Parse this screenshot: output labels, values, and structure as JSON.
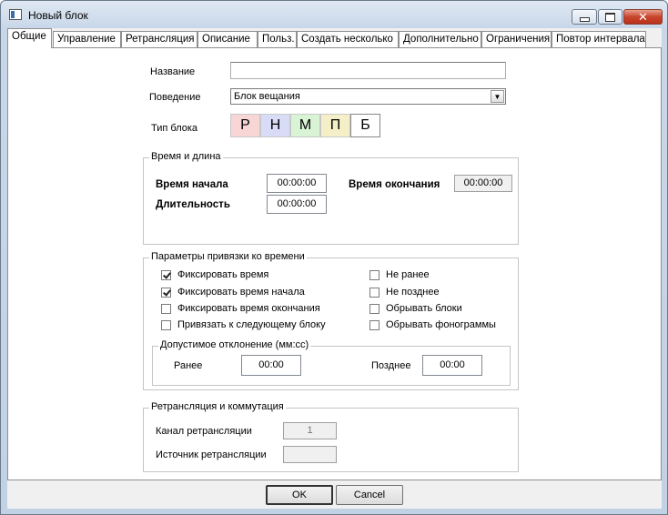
{
  "window": {
    "title": "Новый блок"
  },
  "tabs": [
    "Общие",
    "Управление",
    "Ретрансляция",
    "Описание",
    "Польз.",
    "Создать несколько",
    "Дополнительно",
    "Ограничения",
    "Повтор интервала"
  ],
  "general": {
    "name_label": "Название",
    "name_value": "",
    "behavior_label": "Поведение",
    "behavior_value": "Блок вещания",
    "type_label": "Тип блока",
    "type_buttons": [
      {
        "label": "Р",
        "color": "#f8d6d6"
      },
      {
        "label": "Н",
        "color": "#d9dcf6"
      },
      {
        "label": "М",
        "color": "#d9f4d4"
      },
      {
        "label": "П",
        "color": "#f5efc8"
      },
      {
        "label": "Б",
        "color": "#ffffff"
      }
    ]
  },
  "time_group": {
    "title": "Время и длина",
    "start_label": "Время начала",
    "start_value": "00:00:00",
    "end_label": "Время окончания",
    "end_value": "00:00:00",
    "duration_label": "Длительность",
    "duration_value": "00:00:00"
  },
  "binding_group": {
    "title": "Параметры привязки ко времени",
    "options": [
      {
        "label": "Фиксировать время",
        "checked": true
      },
      {
        "label": "Фиксировать время начала",
        "checked": true
      },
      {
        "label": "Фиксировать время окончания",
        "checked": false
      },
      {
        "label": "Привязать к следующему блоку",
        "checked": false
      },
      {
        "label": "Не ранее",
        "checked": false
      },
      {
        "label": "Не позднее",
        "checked": false
      },
      {
        "label": "Обрывать блоки",
        "checked": false
      },
      {
        "label": "Обрывать фонограммы",
        "checked": false
      }
    ],
    "deviation": {
      "title": "Допустимое отклонение (мм:сс)",
      "earlier_label": "Ранее",
      "earlier_value": "00:00",
      "later_label": "Позднее",
      "later_value": "00:00"
    }
  },
  "relay_group": {
    "title": "Ретрансляция и коммутация",
    "channel_label": "Канал ретрансляции",
    "channel_value": "1",
    "source_label": "Источник ретрансляции",
    "source_value": ""
  },
  "buttons": {
    "ok": "OK",
    "cancel": "Cancel"
  }
}
